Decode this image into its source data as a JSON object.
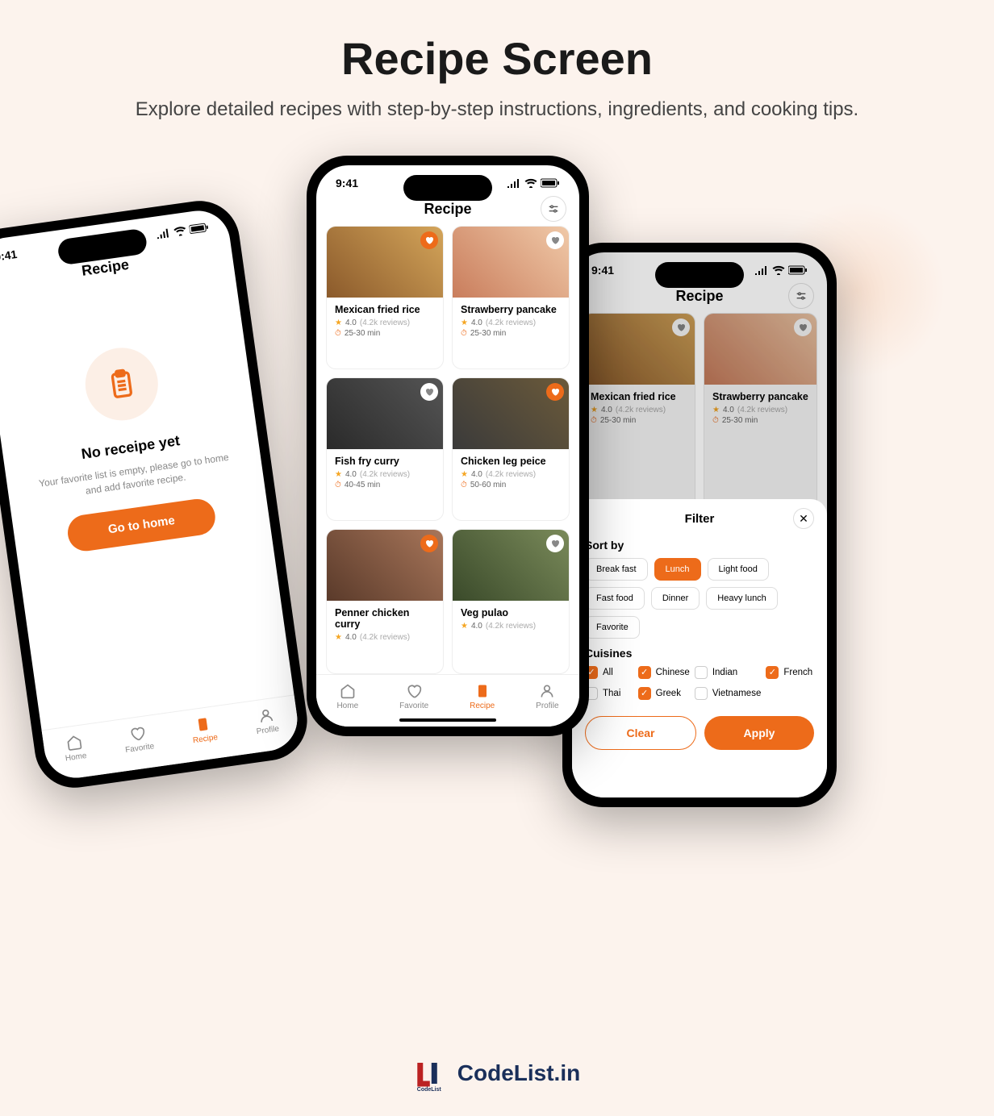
{
  "header": {
    "title": "Recipe Screen",
    "subtitle": "Explore detailed recipes with step-by-step instructions, ingredients, and cooking tips."
  },
  "status_time": "9:41",
  "app_title": "Recipe",
  "phone1": {
    "empty_title": "No receipe yet",
    "empty_text": "Your favorite list is empty, please go to home and add favorite recipe.",
    "cta": "Go to home"
  },
  "nav": {
    "home": "Home",
    "favorite": "Favorite",
    "recipe": "Recipe",
    "profile": "Profile"
  },
  "recipes": [
    {
      "name": "Mexican fried rice",
      "rating": "4.0",
      "reviews": "(4.2k reviews)",
      "time": "25-30 min",
      "fav": true,
      "img": "food1"
    },
    {
      "name": "Strawberry pancake",
      "rating": "4.0",
      "reviews": "(4.2k reviews)",
      "time": "25-30 min",
      "fav": false,
      "img": "food2"
    },
    {
      "name": "Fish fry curry",
      "rating": "4.0",
      "reviews": "(4.2k reviews)",
      "time": "40-45 min",
      "fav": false,
      "img": "food3"
    },
    {
      "name": "Chicken leg peice",
      "rating": "4.0",
      "reviews": "(4.2k reviews)",
      "time": "50-60 min",
      "fav": true,
      "img": "food4"
    },
    {
      "name": "Penner chicken curry",
      "rating": "4.0",
      "reviews": "(4.2k reviews)",
      "time": "",
      "fav": true,
      "img": "food5"
    },
    {
      "name": "Veg pulao",
      "rating": "4.0",
      "reviews": "(4.2k reviews)",
      "time": "",
      "fav": false,
      "img": "food6"
    }
  ],
  "recipes_bg": [
    {
      "name": "Mexican fried rice",
      "rating": "4.0",
      "reviews": "(4.2k reviews)",
      "time": "25-30 min",
      "fav": false,
      "img": "food1"
    },
    {
      "name": "Strawberry pancake",
      "rating": "4.0",
      "reviews": "(4.2k reviews)",
      "time": "25-30 min",
      "fav": false,
      "img": "food2"
    },
    {
      "name": "",
      "rating": "",
      "reviews": "",
      "time": "",
      "fav": false,
      "img": "food3"
    },
    {
      "name": "",
      "rating": "",
      "reviews": "",
      "time": "",
      "fav": true,
      "img": "food4"
    }
  ],
  "filter": {
    "title": "Filter",
    "sort_label": "Sort by",
    "sort_options": [
      {
        "label": "Break fast",
        "on": false
      },
      {
        "label": "Lunch",
        "on": true
      },
      {
        "label": "Light food",
        "on": false
      },
      {
        "label": "Fast food",
        "on": false
      },
      {
        "label": "Dinner",
        "on": false
      },
      {
        "label": "Heavy lunch",
        "on": false
      },
      {
        "label": "Favorite",
        "on": false
      }
    ],
    "cuisines_label": "Cuisines",
    "cuisines": [
      {
        "label": "All",
        "on": true
      },
      {
        "label": "Chinese",
        "on": true
      },
      {
        "label": "Indian",
        "on": false
      },
      {
        "label": "French",
        "on": true
      },
      {
        "label": "Thai",
        "on": false
      },
      {
        "label": "Greek",
        "on": true
      },
      {
        "label": "Vietnamese",
        "on": false
      }
    ],
    "clear": "Clear",
    "apply": "Apply"
  },
  "brand": "CodeList.in"
}
